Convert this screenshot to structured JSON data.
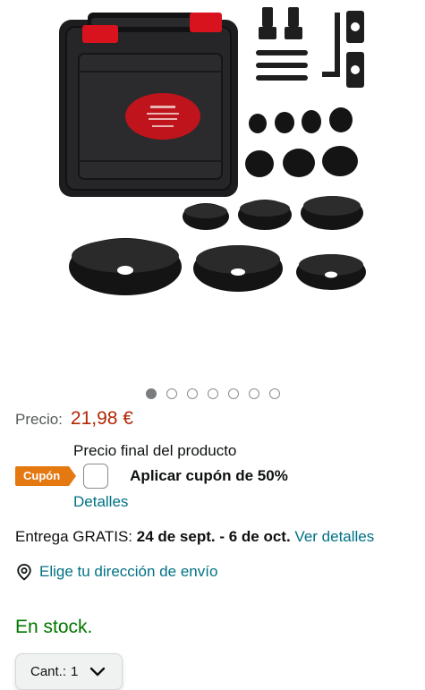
{
  "carousel": {
    "count": 7,
    "active_index": 0
  },
  "price": {
    "label": "Precio:",
    "value": "21,98 €"
  },
  "final_price_label": "Precio final del producto",
  "coupon": {
    "badge": "Cupón",
    "apply_text": "Aplicar cupón de 50%"
  },
  "details_link": "Detalles",
  "delivery": {
    "prefix": "Entrega GRATIS: ",
    "dates": "24 de sept. - 6 de oct.",
    "link": "Ver detalles"
  },
  "address_link": "Elige tu dirección de envío",
  "stock": "En stock.",
  "quantity": {
    "label": "Cant.:",
    "value": "1"
  },
  "colors": {
    "price": "#b12704",
    "link": "#007185",
    "stock": "#007600",
    "coupon": "#e47911"
  }
}
